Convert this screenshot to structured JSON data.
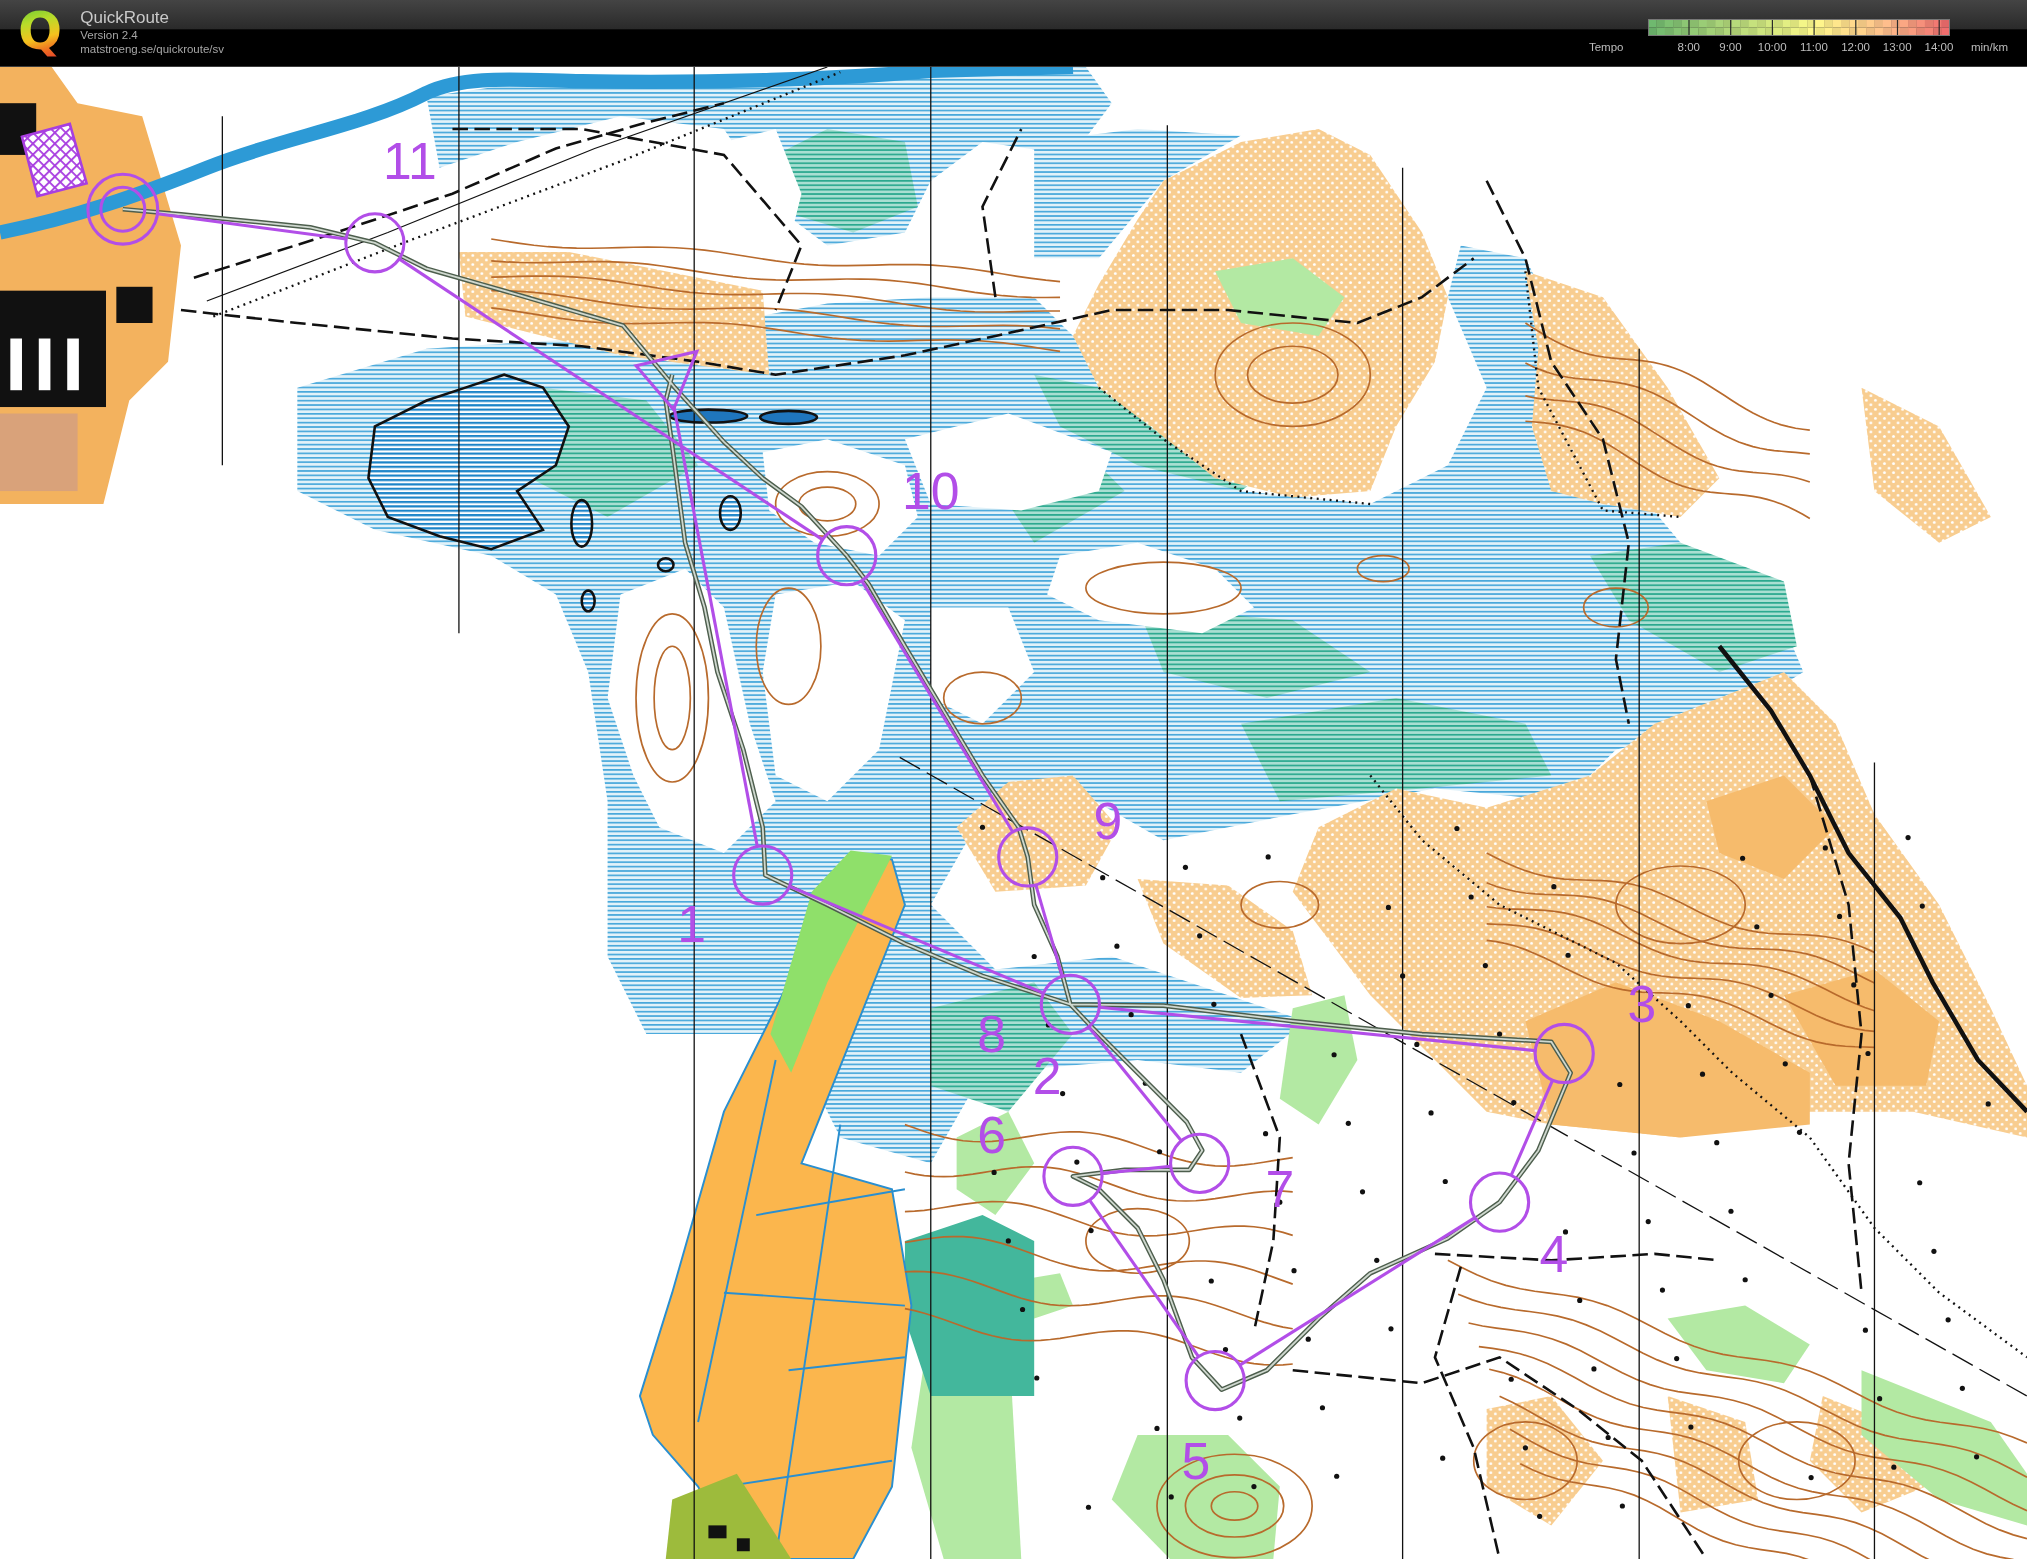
{
  "header": {
    "logo": "Q",
    "title": "QuickRoute",
    "version": "Version 2.4",
    "url": "matstroeng.se/quickroute/sv"
  },
  "tempo_legend": {
    "label": "Tempo",
    "ticks": [
      "8:00",
      "9:00",
      "10:00",
      "11:00",
      "12:00",
      "13:00",
      "14:00"
    ],
    "unit": "min/km"
  },
  "course": {
    "controls": [
      {
        "kind": "start"
      },
      {
        "kind": "control",
        "number": "1"
      },
      {
        "kind": "control",
        "number": "2"
      },
      {
        "kind": "control",
        "number": "3"
      },
      {
        "kind": "control",
        "number": "4"
      },
      {
        "kind": "control",
        "number": "5"
      },
      {
        "kind": "control",
        "number": "6"
      },
      {
        "kind": "control",
        "number": "7"
      },
      {
        "kind": "control",
        "number": "8"
      },
      {
        "kind": "control",
        "number": "9"
      },
      {
        "kind": "control",
        "number": "10"
      },
      {
        "kind": "control",
        "number": "11"
      },
      {
        "kind": "finish"
      }
    ]
  }
}
